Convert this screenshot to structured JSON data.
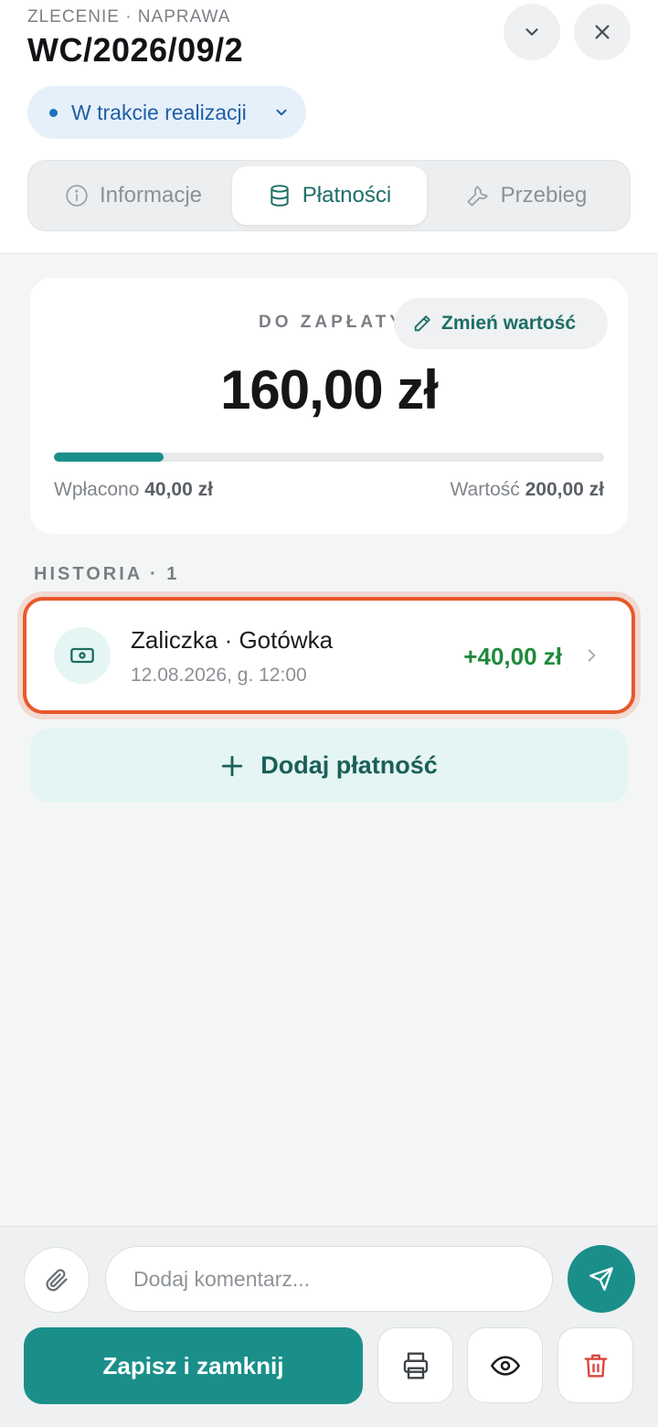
{
  "header": {
    "kicker": "ZLECENIE · NAPRAWA",
    "title": "WC/2026/09/2",
    "collapse_icon": "chevron-down-icon",
    "close_icon": "close-icon",
    "status": {
      "label": "W trakcie realizacji",
      "color": "#1f5fa6"
    }
  },
  "tabs": [
    {
      "label": "Informacje",
      "icon": "info-icon",
      "active": false
    },
    {
      "label": "Płatności",
      "icon": "database-icon",
      "active": true
    },
    {
      "label": "Przebieg",
      "icon": "wrench-icon",
      "active": false
    }
  ],
  "payment": {
    "due_label": "DO ZAPŁATY",
    "edit_label": "Zmień wartość",
    "amount_due": "160,00 zł",
    "paid_fraction": 0.2,
    "paid_label": "Wpłacono",
    "paid_value": "40,00 zł",
    "value_label": "Wartość",
    "value_value": "200,00 zł"
  },
  "history": {
    "label": "HISTORIA · 1",
    "items": [
      {
        "title": "Zaliczka · Gotówka",
        "date": "12.08.2026, g. 12:00",
        "amount": "+40,00 zł",
        "icon": "cash-icon"
      }
    ]
  },
  "add_payment": {
    "label": "Dodaj płatność",
    "icon": "plus-icon"
  },
  "footer": {
    "comment_placeholder": "Dodaj komentarz...",
    "save_label": "Zapisz i zamknij",
    "buttons": [
      "paperclip-icon",
      "send-icon",
      "print-icon",
      "eye-icon",
      "trash-icon"
    ]
  },
  "colors": {
    "accent": "#1a8f8a",
    "positive": "#1f8a3c",
    "highlight": "#e8582a",
    "danger": "#d9463b"
  }
}
